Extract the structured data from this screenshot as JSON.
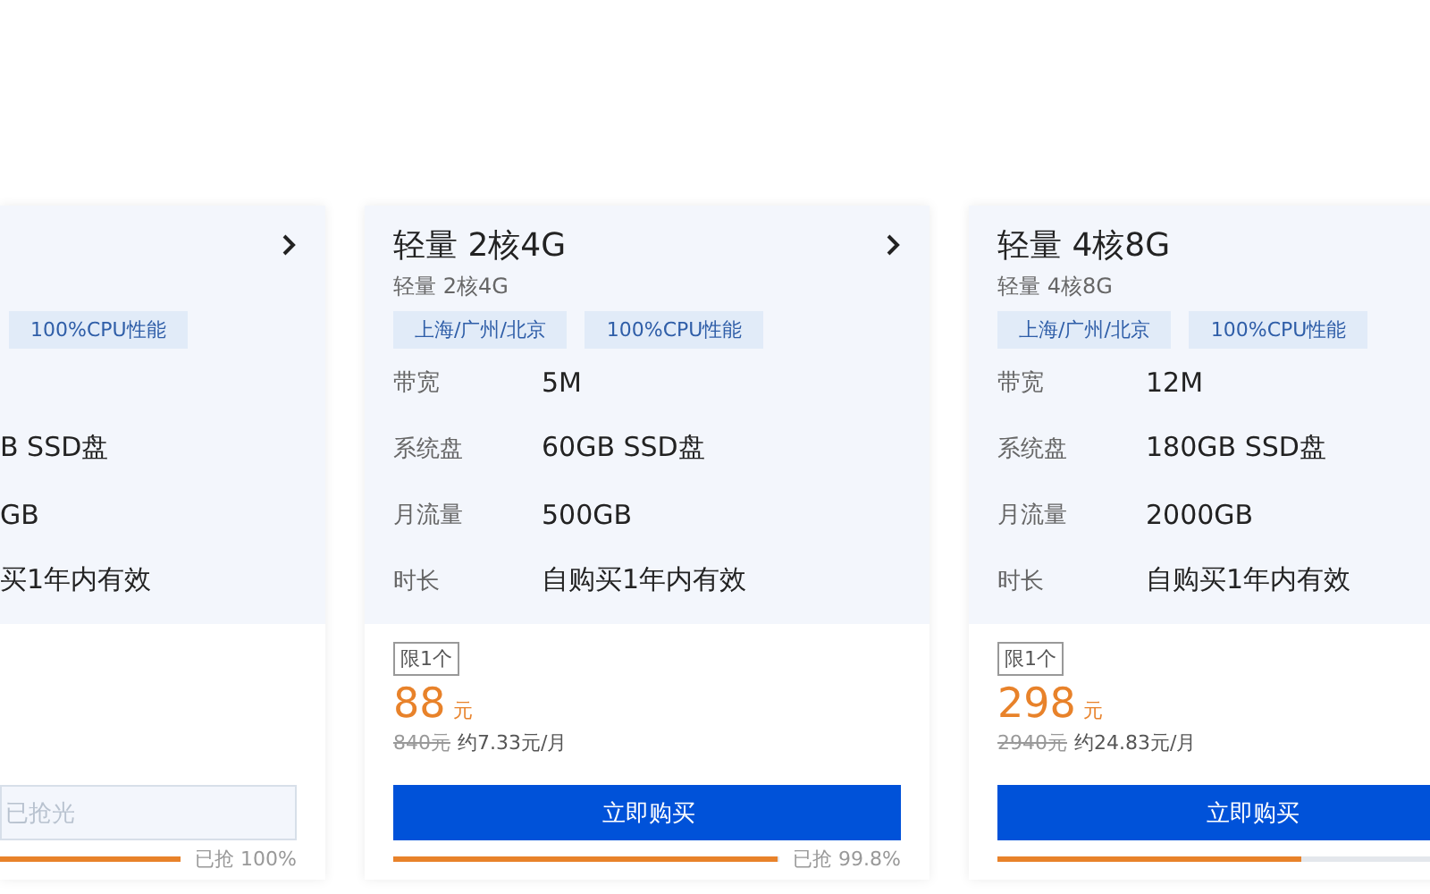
{
  "cards": [
    {
      "chevron": true,
      "tags": [
        "100%CPU性能"
      ],
      "specs": [
        {
          "value": "B SSD盘"
        },
        {
          "value": "GB"
        },
        {
          "value": "买1年内有效"
        }
      ],
      "button": "已抢光",
      "sold_out": true,
      "level": 1,
      "progress_text": "已抢 100%"
    },
    {
      "title": "轻量 2核4G",
      "subtitle": "轻量 2核4G",
      "chevron": true,
      "tags": [
        "上海/广州/北京",
        "100%CPU性能"
      ],
      "specs": [
        {
          "label": "带宽",
          "value": "5M"
        },
        {
          "label": "系统盘",
          "value": "60GB SSD盘"
        },
        {
          "label": "月流量",
          "value": "500GB"
        },
        {
          "label": "时长",
          "value": "自购买1年内有效"
        }
      ],
      "limit": "限1个",
      "price": "88",
      "unit": "元",
      "old_price": "840元",
      "monthly": "约7.33元/月",
      "button": "立即购买",
      "sold_out": false,
      "level": 0.998,
      "progress_text": "已抢 99.8%"
    },
    {
      "title": "轻量 4核8G",
      "subtitle": "轻量 4核8G",
      "tags": [
        "上海/广州/北京",
        "100%CPU性能"
      ],
      "specs": [
        {
          "label": "带宽",
          "value": "12M"
        },
        {
          "label": "系统盘",
          "value": "180GB SSD盘"
        },
        {
          "label": "月流量",
          "value": "2000GB"
        },
        {
          "label": "时长",
          "value": "自购买1年内有效"
        }
      ],
      "limit": "限1个",
      "price": "298",
      "unit": "元",
      "old_price": "2940元",
      "monthly": "约24.83元/月",
      "button": "立即购买",
      "sold_out": false,
      "level": 0.6
    }
  ]
}
